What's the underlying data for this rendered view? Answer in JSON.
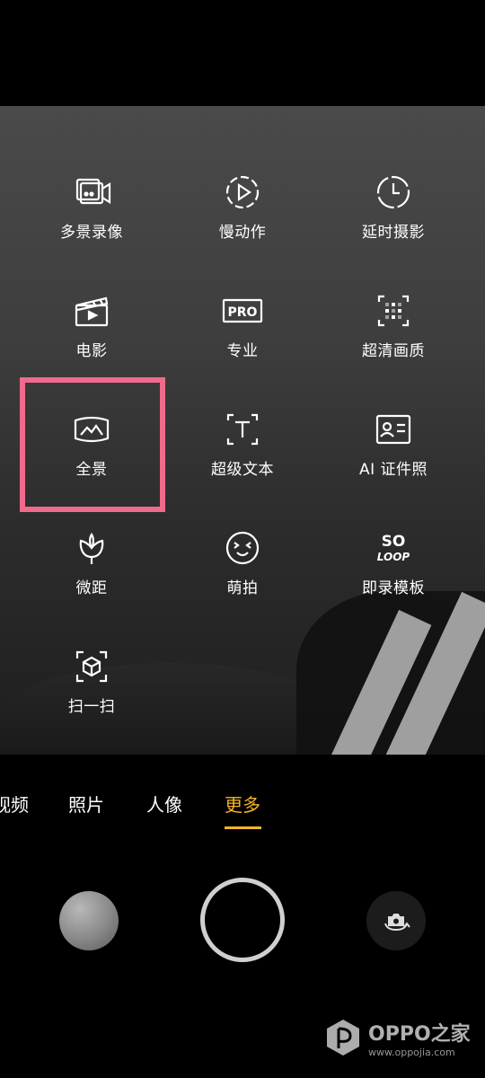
{
  "modes": [
    {
      "label": "多景录像",
      "icon": "multi-scene-video-icon"
    },
    {
      "label": "慢动作",
      "icon": "slow-motion-icon"
    },
    {
      "label": "延时摄影",
      "icon": "time-lapse-icon"
    },
    {
      "label": "电影",
      "icon": "movie-clapper-icon"
    },
    {
      "label": "专业",
      "icon": "pro-mode-icon"
    },
    {
      "label": "超清画质",
      "icon": "ultra-clear-icon"
    },
    {
      "label": "全景",
      "icon": "panorama-icon"
    },
    {
      "label": "超级文本",
      "icon": "super-text-icon"
    },
    {
      "label": "AI 证件照",
      "icon": "id-photo-icon"
    },
    {
      "label": "微距",
      "icon": "macro-flower-icon"
    },
    {
      "label": "萌拍",
      "icon": "cute-face-icon"
    },
    {
      "label": "即录模板",
      "icon": "solo-template-icon"
    },
    {
      "label": "扫一扫",
      "icon": "scan-icon"
    }
  ],
  "pro_icon_text": "PRO",
  "solo_icon_text": {
    "top": "SO",
    "bottom": "LOOP"
  },
  "tabs": [
    {
      "label": "视频",
      "active": false
    },
    {
      "label": "照片",
      "active": false
    },
    {
      "label": "人像",
      "active": false
    },
    {
      "label": "更多",
      "active": true
    }
  ],
  "accent_color": "#f7b529",
  "highlight_color": "#f06a8c",
  "watermark": {
    "title": "OPPO之家",
    "url": "www.oppojia.com"
  }
}
